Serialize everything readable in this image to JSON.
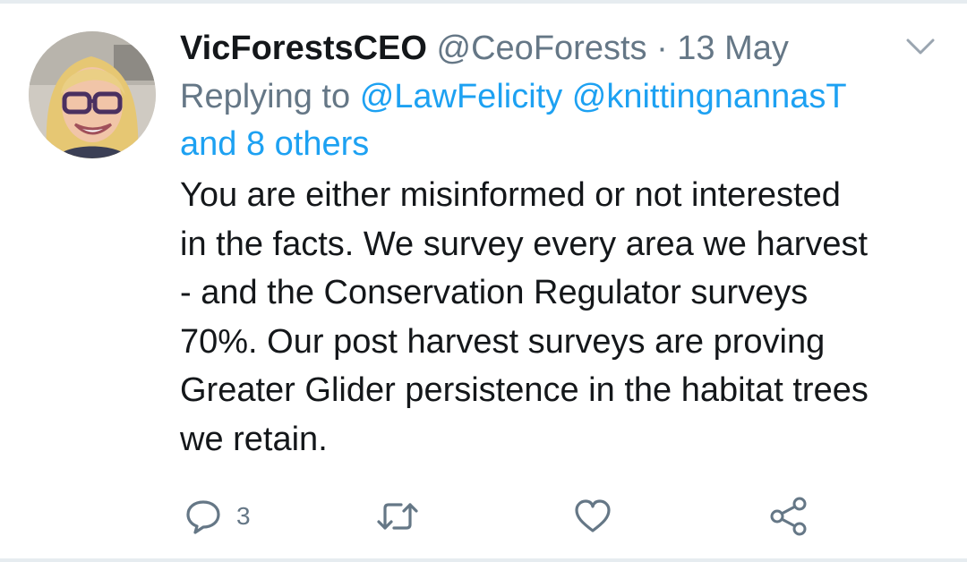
{
  "tweet": {
    "author_name": "VicForestsCEO",
    "handle": "@CeoForests",
    "separator": "·",
    "date": "13 May",
    "replying_prefix": "Replying to",
    "mentions": [
      "@LawFelicity",
      "@knittingnannasT"
    ],
    "others": "and 8 others",
    "text_lines": [
      "You are either misinformed or not interested",
      "in the facts.  We survey every area we harvest",
      "- and the Conservation Regulator surveys",
      "70%.  Our post harvest surveys are proving",
      "Greater Glider persistence in the habitat trees",
      "we retain."
    ],
    "actions": {
      "reply_icon": "reply-icon",
      "reply_count": "3",
      "retweet_icon": "retweet-icon",
      "like_icon": "heart-icon",
      "share_icon": "share-icon"
    },
    "menu_icon": "chevron-down-icon"
  },
  "colors": {
    "text": "#14171a",
    "muted": "#657786",
    "link": "#1da1f2",
    "divider": "#e6ecf0"
  }
}
